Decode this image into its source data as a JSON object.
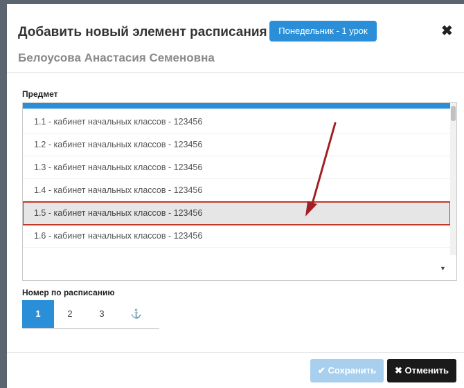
{
  "dialog": {
    "title": "Добавить новый элемент расписания",
    "badge": "Понедельник - 1 урок",
    "close_glyph": "✖",
    "subtitle": "Белоусова Анастасия Семеновна"
  },
  "subject": {
    "label": "Предмет",
    "options": [
      "1.1 - кабинет начальных классов - 123456",
      "1.2 - кабинет начальных классов - 123456",
      "1.3 - кабинет начальных классов - 123456",
      "1.4 - кабинет начальных классов - 123456",
      "1.5 - кабинет начальных классов - 123456",
      "1.6 - кабинет начальных классов - 123456"
    ],
    "highlighted_index": 4,
    "caret": "▼"
  },
  "schedule_number": {
    "label": "Номер по расписанию",
    "tabs": [
      "1",
      "2",
      "3",
      "⚓"
    ],
    "active_index": 0
  },
  "footer": {
    "save_label": "Сохранить",
    "save_icon": "check-icon",
    "cancel_label": "Отменить",
    "cancel_icon": "x-icon"
  },
  "annotation_color": "#a31f24"
}
